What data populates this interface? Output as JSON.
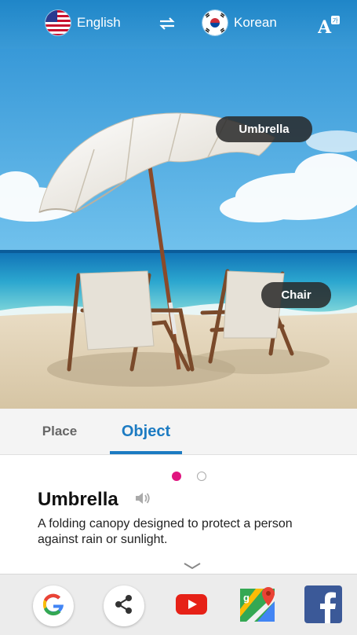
{
  "header": {
    "source_language": "English",
    "target_language": "Korean",
    "swap_icon": "swap-arrows-icon",
    "translate_icon": "translate-font-icon"
  },
  "image_labels": {
    "umbrella": "Umbrella",
    "chair": "Chair"
  },
  "tabs": [
    {
      "label": "Place",
      "active": false
    },
    {
      "label": "Object",
      "active": true
    }
  ],
  "pagination": {
    "current": 1,
    "total": 2
  },
  "result": {
    "word": "Umbrella",
    "definition": "A folding canopy designed to protect a person against rain or sunlight."
  },
  "apps": [
    {
      "name": "Google",
      "icon": "google-icon"
    },
    {
      "name": "Share",
      "icon": "share-icon"
    },
    {
      "name": "YouTube",
      "icon": "youtube-icon"
    },
    {
      "name": "Maps",
      "icon": "maps-icon"
    },
    {
      "name": "Facebook",
      "icon": "facebook-icon"
    }
  ],
  "colors": {
    "header_blue": "#1f86c8",
    "accent_blue": "#1c7bc2",
    "active_dot": "#e0157f"
  }
}
